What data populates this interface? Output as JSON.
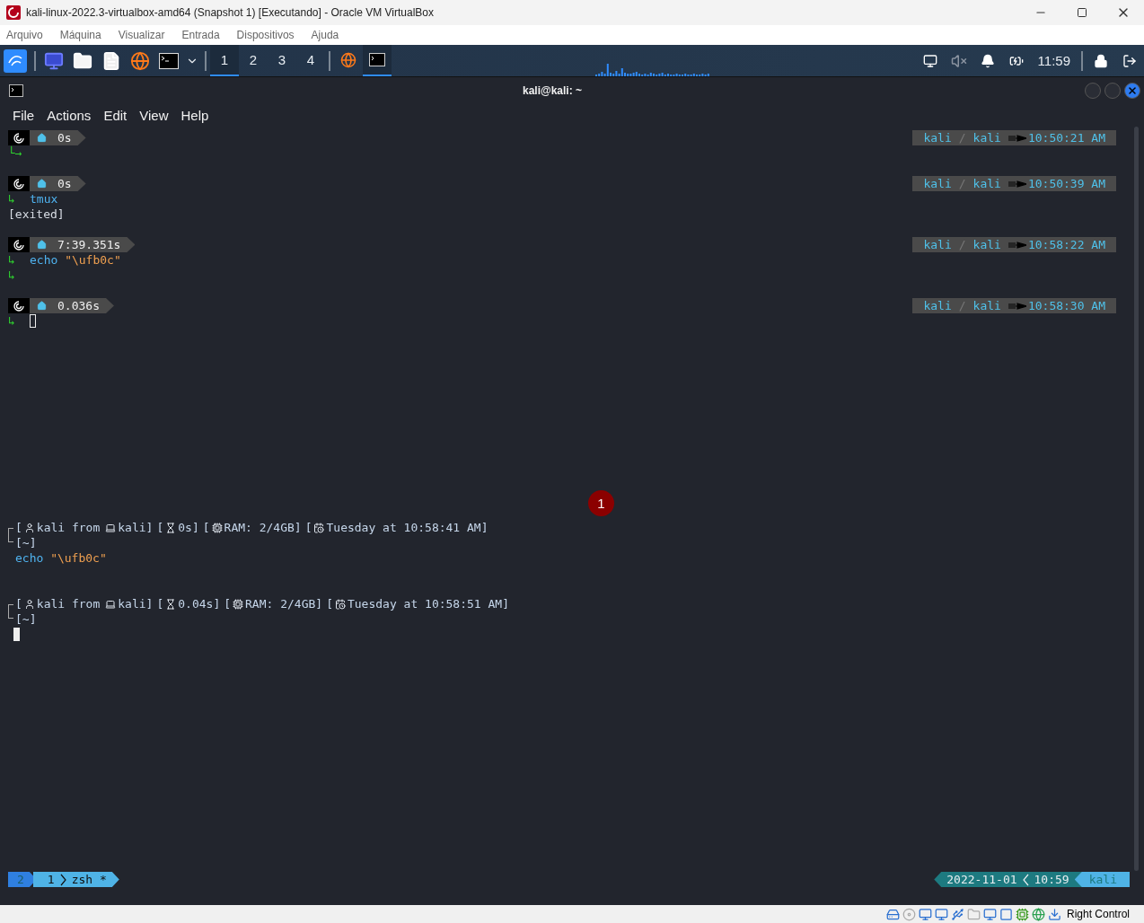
{
  "window": {
    "title": "kali-linux-2022.3-virtualbox-amd64 (Snapshot 1) [Executando] - Oracle VM VirtualBox"
  },
  "menu": [
    "Arquivo",
    "Máquina",
    "Visualizar",
    "Entrada",
    "Dispositivos",
    "Ajuda"
  ],
  "panel": {
    "workspaces": [
      {
        "label": "1",
        "selected": true
      },
      {
        "label": "2",
        "selected": false
      },
      {
        "label": "3",
        "selected": false
      },
      {
        "label": "4",
        "selected": false
      }
    ],
    "tasks": [
      {
        "kind": "browser",
        "selected": false
      },
      {
        "kind": "terminal",
        "selected": true
      }
    ],
    "clock": "11:59"
  },
  "terminal": {
    "title": "kali@kali: ~",
    "menu": [
      "File",
      "Actions",
      "Edit",
      "View",
      "Help"
    ],
    "blocks": [
      [
        {
          "kind": "prompt",
          "duration": "0s",
          "right": {
            "user": "kali",
            "sep": "/",
            "host": "kali",
            "time": "10:50:21 AM"
          }
        },
        {
          "kind": "arrow",
          "arrow": "└→"
        },
        {
          "kind": "blank"
        },
        {
          "kind": "prompt",
          "duration": "0s",
          "right": {
            "user": "kali",
            "sep": "/",
            "host": "kali",
            "time": "10:50:39 AM"
          }
        },
        {
          "kind": "command",
          "arrow": "↳",
          "cmd": "tmux"
        },
        {
          "kind": "output",
          "text": "[exited]"
        },
        {
          "kind": "blank"
        },
        {
          "kind": "prompt",
          "duration": "7:39.351s",
          "right": {
            "user": "kali",
            "sep": "/",
            "host": "kali",
            "time": "10:58:22 AM"
          }
        },
        {
          "kind": "command",
          "arrow": "↳",
          "cmd": "echo",
          "arg": "\"\\ufb0c\""
        },
        {
          "kind": "arrow",
          "arrow": "↳"
        },
        {
          "kind": "blank"
        },
        {
          "kind": "prompt",
          "duration": "0.036s",
          "right": {
            "user": "kali",
            "sep": "/",
            "host": "kali",
            "time": "10:58:30 AM"
          }
        },
        {
          "kind": "cursor",
          "arrow": "↳",
          "filled": false
        }
      ],
      [
        {
          "kind": "info",
          "segments": [
            {
              "pre": "[",
              "text": "kali from"
            },
            {
              "text": "kali]"
            },
            {
              "pre": "[",
              "text": "0s]"
            },
            {
              "pre": "[",
              "text": "RAM: 2/4GB]"
            },
            {
              "pre": "[",
              "text": "Tuesday at 10:58:41 AM]"
            }
          ]
        },
        {
          "kind": "cwd",
          "text": "[~]"
        },
        {
          "kind": "command",
          "cmd": "echo",
          "arg": "\"\\ufb0c\""
        },
        {
          "kind": "blank"
        },
        {
          "kind": "blank"
        },
        {
          "kind": "info",
          "segments": [
            {
              "pre": "[",
              "text": "kali from"
            },
            {
              "text": "kali]"
            },
            {
              "pre": "[",
              "text": "0.04s]"
            },
            {
              "pre": "[",
              "text": "RAM: 2/4GB]"
            },
            {
              "pre": "[",
              "text": "Tuesday at 10:58:51 AM]"
            }
          ]
        },
        {
          "kind": "cwd",
          "text": "[~]"
        },
        {
          "kind": "cursor",
          "filled": true
        }
      ]
    ],
    "marker": "1",
    "tmux": {
      "session": "2",
      "window_index": "1",
      "window_name": "zsh *",
      "date": "2022-11-01",
      "time": "10:59",
      "host": "kali"
    }
  },
  "status_bar": {
    "host_key": "Right Control"
  }
}
